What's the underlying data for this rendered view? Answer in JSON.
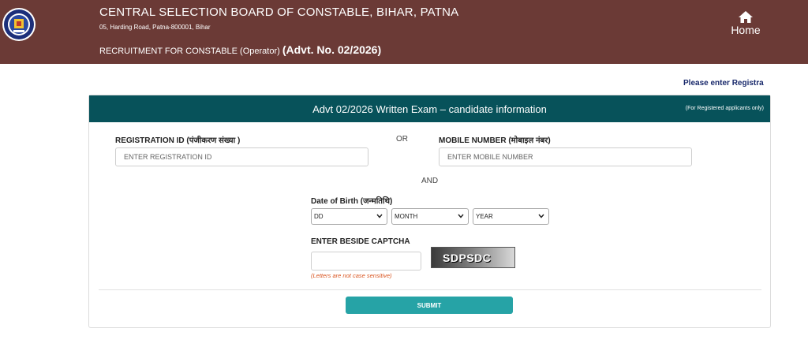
{
  "header": {
    "title": "CENTRAL SELECTION BOARD OF CONSTABLE, BIHAR, PATNA",
    "address": "05, Harding Road, Patna-800001, Bihar",
    "recruitment": "RECRUITMENT FOR CONSTABLE (Operator)",
    "advt": "(Advt. No. 02/2026)",
    "home_label": "Home",
    "bg_color": "#6b3a36"
  },
  "notice": "Please enter Registra",
  "card": {
    "title": "Advt 02/2026 Written Exam – candidate information",
    "note": "(For Registered applicants only)",
    "header_color": "#07525a"
  },
  "form": {
    "registration_label": "REGISTRATION ID (पंजीकरण संख्या )",
    "registration_placeholder": "ENTER REGISTRATION ID",
    "or_text": "OR",
    "mobile_label": "MOBILE NUMBER (मोबाइल नंबर)",
    "mobile_placeholder": "ENTER MOBILE NUMBER",
    "and_text": "AND",
    "dob_label": "Date of Birth (जन्मतिथि)",
    "dob_day": "DD",
    "dob_month": "MONTH",
    "dob_year": "YEAR",
    "captcha_label": "ENTER BESIDE CAPTCHA",
    "captcha_text": "SDPSDC",
    "captcha_hint": "(Letters are not case sensitive)",
    "submit_label": "SUBMIT",
    "submit_color": "#26a3a6"
  },
  "icons": {
    "logo": "emblem-logo-icon",
    "home": "home-icon",
    "dropdown": "chevron-down-icon"
  }
}
